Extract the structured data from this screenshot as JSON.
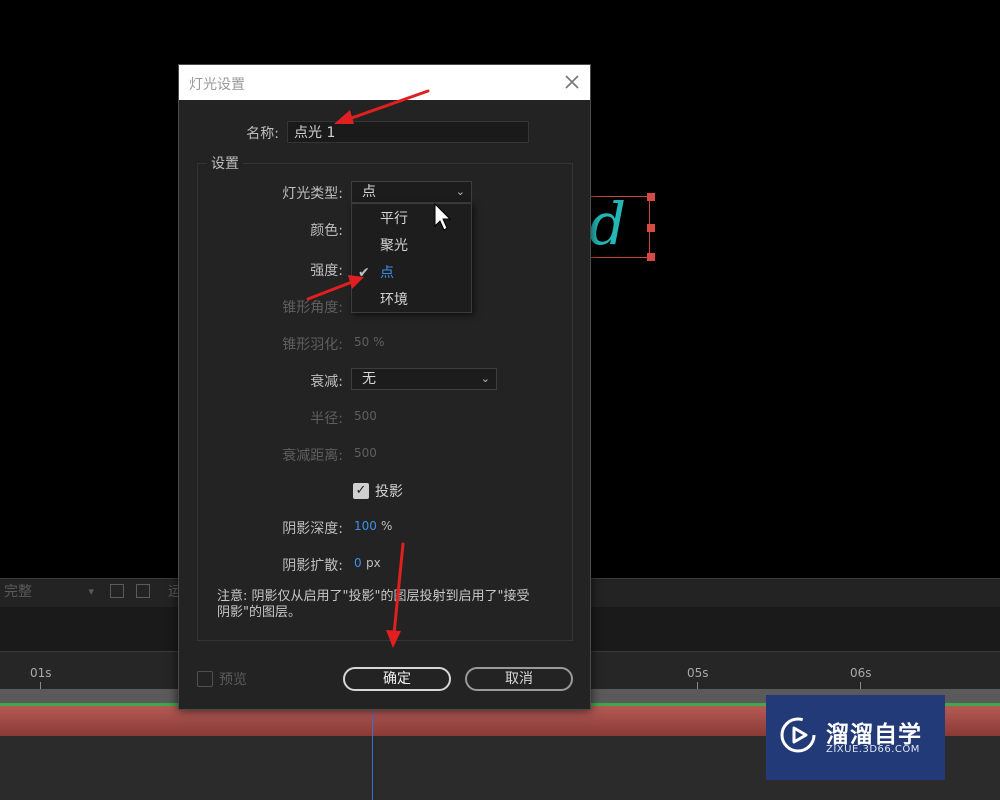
{
  "viewer": {
    "text_layer_glyph": "d"
  },
  "viewer_toolbar": {
    "resolution": "完整",
    "extra_label": "运"
  },
  "timeline": {
    "ticks": [
      "01s",
      "05s",
      "06s"
    ]
  },
  "watermark": {
    "title": "溜溜自学",
    "url": "ZIXUE.3D66.COM"
  },
  "dialog": {
    "title": "灯光设置",
    "name_label": "名称:",
    "name_value": "点光 1",
    "settings_legend": "设置",
    "light_type_label": "灯光类型:",
    "light_type_value": "点",
    "light_type_options": [
      {
        "label": "平行",
        "selected": false
      },
      {
        "label": "聚光",
        "selected": false
      },
      {
        "label": "点",
        "selected": true
      },
      {
        "label": "环境",
        "selected": false
      }
    ],
    "color_label": "颜色:",
    "intensity_label": "强度:",
    "cone_angle_label": "锥形角度:",
    "cone_feather_label": "锥形羽化:",
    "cone_feather_value": "50 %",
    "falloff_label": "衰减:",
    "falloff_value": "无",
    "radius_label": "半径:",
    "radius_value": "500",
    "falloff_distance_label": "衰减距离:",
    "falloff_distance_value": "500",
    "casts_shadows_label": "投影",
    "casts_shadows_checked": true,
    "shadow_darkness_label": "阴影深度:",
    "shadow_darkness_value": "100",
    "shadow_darkness_unit": "%",
    "shadow_diffusion_label": "阴影扩散:",
    "shadow_diffusion_value": "0",
    "shadow_diffusion_unit": "px",
    "note": "注意: 阴影仅从启用了\"投影\"的图层投射到启用了\"接受阴影\"的图层。",
    "preview_label": "预览",
    "ok_label": "确定",
    "cancel_label": "取消"
  },
  "colors": {
    "accent_blue": "#3f8fe8",
    "layer_teal": "#24b7b7",
    "annotation_red": "#e02020",
    "watermark_bg": "#233a78"
  }
}
